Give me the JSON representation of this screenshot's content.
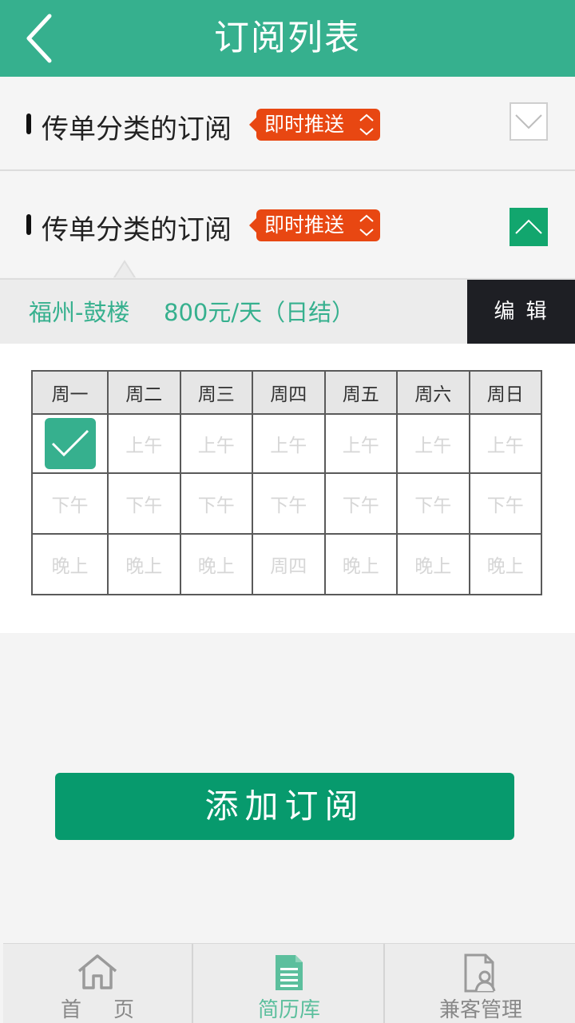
{
  "header": {
    "title": "订阅列表"
  },
  "subscriptions": [
    {
      "label": "传单分类的订阅",
      "badge": "即时推送",
      "state": "collapsed"
    },
    {
      "label": "传单分类的订阅",
      "badge": "即时推送",
      "state": "expanded"
    }
  ],
  "detail": {
    "city": "福州-鼓楼",
    "pay": "800元/天（日结）",
    "edit_label": "编辑"
  },
  "schedule": {
    "days": [
      "周一",
      "周二",
      "周三",
      "周四",
      "周五",
      "周六",
      "周日"
    ],
    "rows": [
      {
        "cells": [
          "",
          "上午",
          "上午",
          "上午",
          "上午",
          "上午",
          "上午"
        ]
      },
      {
        "cells": [
          "下午",
          "下午",
          "下午",
          "下午",
          "下午",
          "下午",
          "下午"
        ]
      },
      {
        "cells": [
          "晚上",
          "晚上",
          "晚上",
          "周四",
          "晚上",
          "晚上",
          "晚上"
        ]
      }
    ],
    "checked": "周一 上午"
  },
  "add_button": "添加订阅",
  "tabbar": {
    "items": [
      {
        "label": "首页",
        "icon": "home-icon",
        "active": false
      },
      {
        "label": "简历库",
        "icon": "document-icon",
        "active": true
      },
      {
        "label": "兼客管理",
        "icon": "person-document-icon",
        "active": false
      }
    ]
  },
  "colors": {
    "primary": "#36b08e",
    "button": "#079a6d",
    "badge": "#e84712",
    "edit": "#1e1f24"
  }
}
